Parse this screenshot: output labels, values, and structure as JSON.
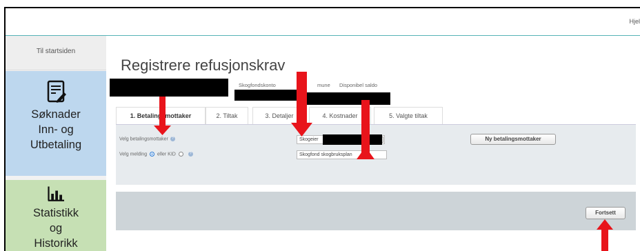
{
  "topbar": {
    "help_label": "Hjel"
  },
  "sidebar": {
    "home_label": "Til startsiden",
    "tiles": [
      {
        "label": "Søknader\nInn- og\nUtbetaling",
        "icon": "form-edit-icon"
      },
      {
        "label": "Statistikk\nog\nHistorikk",
        "icon": "bar-chart-icon"
      }
    ]
  },
  "main": {
    "title": "Registrere refusjonskrav",
    "info_labels": [
      "Skogfondskonto",
      "mune",
      "Disponibel saldo"
    ],
    "tabs": [
      {
        "label": "1. Betalingsmottaker",
        "active": true
      },
      {
        "label": "2. Tiltak",
        "active": false
      },
      {
        "label": "3. Detaljer",
        "active": false
      },
      {
        "label": "4. Kostnader",
        "active": false
      },
      {
        "label": "5. Valgte tiltak",
        "active": false
      }
    ],
    "form": {
      "payee_label": "Velg betalingsmottaker",
      "message_label": "Velg melding",
      "or_label": "eller KID",
      "payee_select_value": "Skogeier",
      "message_value": "Skogfond skogbruksplan",
      "new_payee_button": "Ny betalingsmottaker"
    },
    "next_button": "Fortsett"
  },
  "annotations": {
    "arrow_color": "#e8141b",
    "redaction_color": "#000000"
  }
}
